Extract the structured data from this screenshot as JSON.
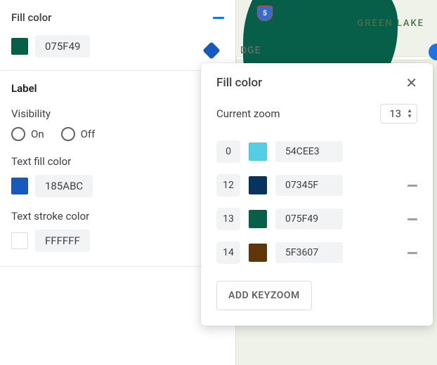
{
  "left": {
    "fill_color": {
      "title": "Fill color",
      "hex": "075F49",
      "swatch": "#075F49"
    },
    "label": {
      "heading": "Label",
      "visibility": {
        "label": "Visibility",
        "on": "On",
        "off": "Off"
      },
      "text_fill": {
        "label": "Text fill color",
        "hex": "185ABC",
        "swatch": "#185ABC"
      },
      "text_stroke": {
        "label": "Text stroke color",
        "hex": "FFFFFF",
        "swatch": "#FFFFFF"
      }
    }
  },
  "map": {
    "green_lake": "GREEN LAKE",
    "dge": "DGE",
    "i5": "5"
  },
  "popup": {
    "title": "Fill color",
    "current_zoom_label": "Current zoom",
    "current_zoom_value": "13",
    "rows": [
      {
        "zoom": "0",
        "color": "#54CEE3",
        "hex": "54CEE3",
        "removable": false
      },
      {
        "zoom": "12",
        "color": "#07345F",
        "hex": "07345F",
        "removable": true
      },
      {
        "zoom": "13",
        "color": "#075F49",
        "hex": "075F49",
        "removable": true
      },
      {
        "zoom": "14",
        "color": "#5F3607",
        "hex": "5F3607",
        "removable": true
      }
    ],
    "add_button": "ADD KEYZOOM"
  }
}
